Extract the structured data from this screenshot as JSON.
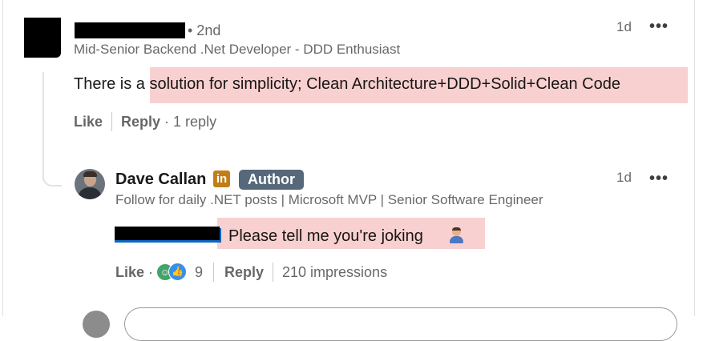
{
  "comment1": {
    "author_name_redacted": "",
    "degree": "• 2nd",
    "headline": "Mid-Senior Backend .Net Developer - DDD Enthusiast",
    "time": "1d",
    "more": "•••",
    "text_prefix": "There is a ",
    "text_highlight": "solution for simplicity; Clean Architecture+DDD+Solid+Clean Code",
    "like_label": "Like",
    "reply_label": "Reply",
    "reply_count": "· 1 reply"
  },
  "reply": {
    "author_name": "Dave Callan",
    "linkedin_badge": "in",
    "author_badge": "Author",
    "headline": "Follow for daily .NET posts | Microsoft MVP | Senior Software Engineer",
    "time": "1d",
    "more": "•••",
    "text": "Please tell me you're joking",
    "like_label": "Like",
    "like_dot": "·",
    "reaction_count": "9",
    "reply_label": "Reply",
    "impressions": "210 impressions"
  },
  "colors": {
    "highlight": "#f8d0d0",
    "author_badge_bg": "#56687a",
    "linkedin_badge_bg": "#c37d16"
  }
}
